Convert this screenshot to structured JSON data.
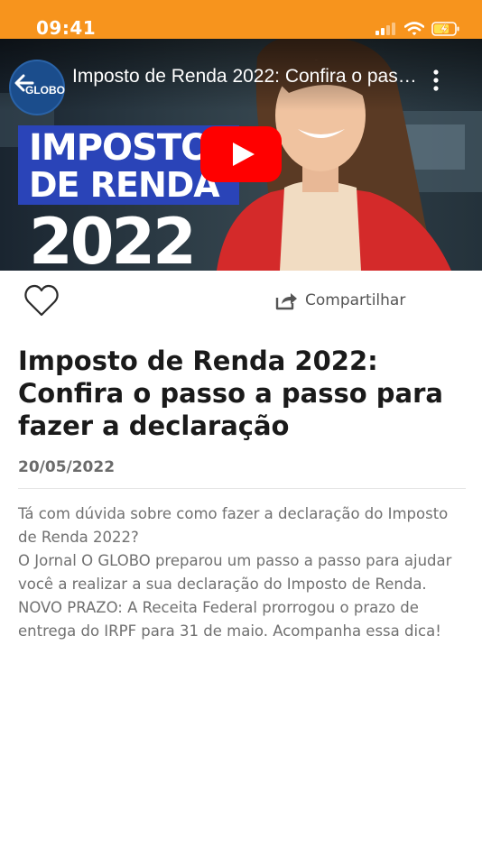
{
  "status_bar": {
    "time": "09:41",
    "background_color": "#f7941d",
    "icons": [
      "cellular-signal-icon",
      "wifi-icon",
      "battery-charging-icon"
    ]
  },
  "video": {
    "channel_logo_text": "GLOBO",
    "title": "Imposto de Renda 2022: Confira o passo a passo para fazer a declaração",
    "thumbnail_text": [
      "IMPOSTO",
      "DE RENDA",
      "2022"
    ],
    "play_button_color": "#ff0000",
    "icons": [
      "back-arrow-icon",
      "more-vertical-icon",
      "play-icon"
    ]
  },
  "actions": {
    "like_icon": "heart-outline-icon",
    "share_icon": "share-icon",
    "share_label": "Compartilhar"
  },
  "article": {
    "title": "Imposto de Renda 2022: Confira o passo a passo para fazer a declaração",
    "date": "20/05/2022",
    "paragraphs": [
      "Tá com dúvida sobre como fazer a declaração do Imposto de Renda 2022?",
      "O Jornal O GLOBO preparou um passo a passo para ajudar você a realizar a sua declaração do Imposto de Renda.",
      "NOVO PRAZO: A Receita Federal prorrogou o prazo de entrega do IRPF para 31 de maio. Acompanha essa dica!"
    ]
  }
}
